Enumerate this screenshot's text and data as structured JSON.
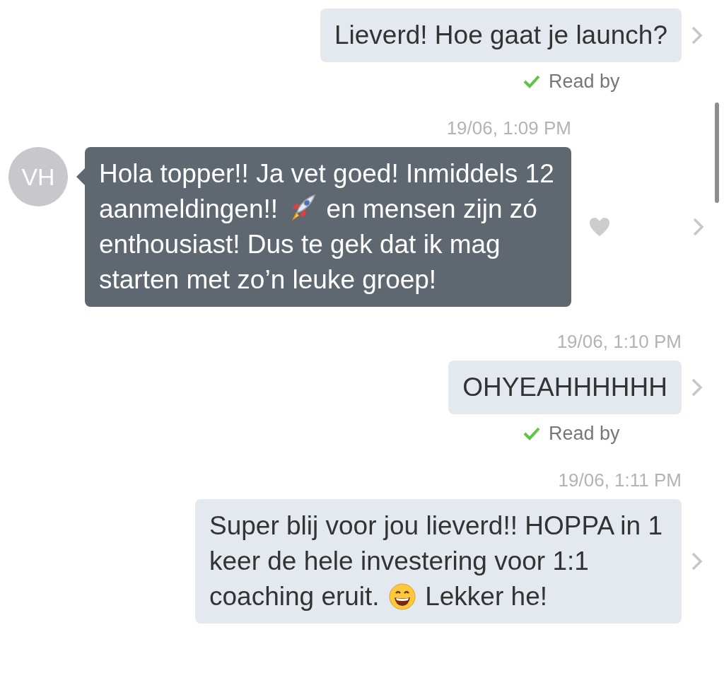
{
  "messages": [
    {
      "kind": "outgoing",
      "parts": [
        {
          "kind": "text",
          "text": "Lieverd! Hoe gaat je launch?"
        }
      ],
      "receipt": "Read by"
    },
    {
      "kind": "incoming",
      "timestamp": "19/06, 1:09 PM",
      "avatar": "VH",
      "parts": [
        {
          "kind": "text",
          "text": "Hola topper!! Ja vet goed! Inmiddels 12 aanmeldingen!! "
        },
        {
          "kind": "rocket"
        },
        {
          "kind": "text",
          "text": " en mensen zijn zó enthousiast! Dus te gek dat ik mag starten met zo’n leuke groep!"
        }
      ],
      "liked": false
    },
    {
      "kind": "outgoing",
      "timestamp": "19/06, 1:10 PM",
      "parts": [
        {
          "kind": "text",
          "text": "OHYEAHHHHHH"
        }
      ],
      "receipt": "Read by"
    },
    {
      "kind": "outgoing",
      "timestamp": "19/06, 1:11 PM",
      "parts": [
        {
          "kind": "text",
          "text": "Super blij voor jou lieverd!! HOPPA in 1 keer de hele investering voor 1:1 coaching eruit. "
        },
        {
          "kind": "smiley"
        },
        {
          "kind": "text",
          "text": " Lekker he!"
        }
      ]
    }
  ]
}
